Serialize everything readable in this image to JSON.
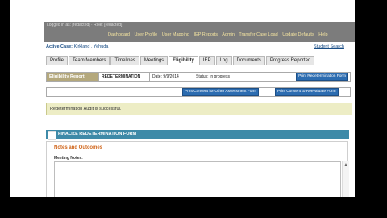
{
  "header": {
    "user_line": "Logged in as: [redacted] · Role: [redacted]",
    "menu": [
      "Dashboard",
      "User Profile",
      "User Mapping",
      "IEP Reports",
      "Admin",
      "Transfer Case Load",
      "Update Defaults",
      "Help"
    ]
  },
  "case": {
    "active_label": "Active Case:",
    "active_value": "Kirkland , Yehuda",
    "student_search": "Student Search"
  },
  "tabs": [
    "Profile",
    "Team Members",
    "Timelines",
    "Meetings",
    "Eligibility",
    "IEP",
    "Log",
    "Documents",
    "Progress Reported"
  ],
  "eligibility": {
    "title": "Eligibility Report",
    "type": "REDETERMINATION",
    "date": "Date: 9/9/2014",
    "status": "Status: In progress",
    "print_button": "Print Redetermination Form"
  },
  "consent": {
    "other_button": "Print Consent for Other Assessment Form",
    "reevaluate_button": "Print Consent to Reevaluate Form"
  },
  "message": "Redetermination Audit is successful.",
  "form": {
    "header": "FINALIZE REDETERMINATION FORM",
    "notes_title": "Notes and Outcomes",
    "meeting_notes_label": "Meeting Notes:",
    "meeting_notes_value": ""
  }
}
